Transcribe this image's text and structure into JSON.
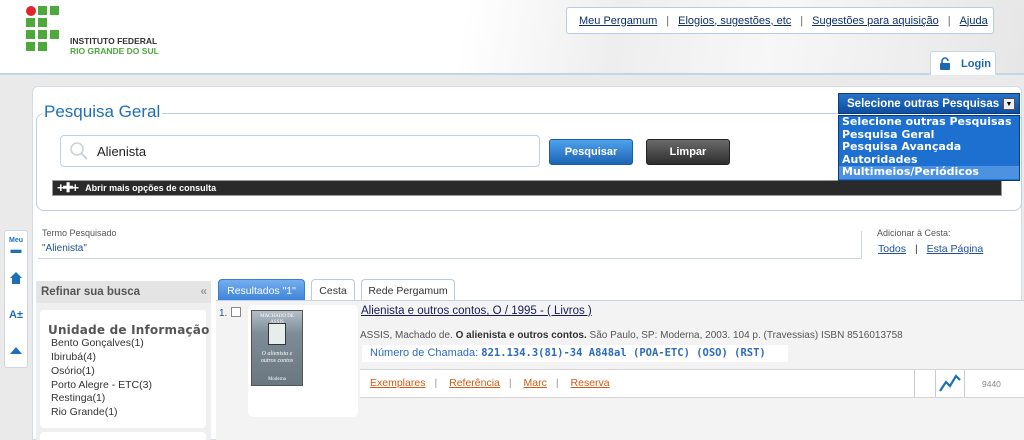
{
  "logo": {
    "line1": "INSTITUTO FEDERAL",
    "line2": "RIO GRANDE DO SUL",
    "brand_color": "#4ea93c",
    "dot_color": "#e0262c"
  },
  "topnav": {
    "items": [
      "Meu Pergamum",
      "Elogios, sugestões, etc",
      "Sugestões para aquisição",
      "Ajuda"
    ]
  },
  "login": {
    "label": "Login",
    "icon": "padlock-icon"
  },
  "search": {
    "legend": "Pesquisa Geral",
    "value": "Alienista",
    "search_button": "Pesquisar",
    "clear_button": "Limpar",
    "more_options": "Abrir mais opções de consulta"
  },
  "select_search": {
    "selected": "Selecione outras Pesquisas",
    "options": [
      "Selecione outras Pesquisas",
      "Pesquisa Geral",
      "Pesquisa Avançada",
      "Autoridades",
      "Multimeios/Periódicos"
    ],
    "highlighted_index": 4
  },
  "side_tools": {
    "items": [
      "Meu",
      "home-icon",
      "A±",
      "up-arrow-icon"
    ]
  },
  "termo": {
    "label": "Termo Pesquisado",
    "value": "\"Alienista\""
  },
  "cesta": {
    "label": "Adicionar à Cesta:",
    "all": "Todos",
    "sep": "|",
    "page": "Esta Página"
  },
  "refine": {
    "title": "Refinar sua busca",
    "unit_title": "Unidade de Informação",
    "units": [
      "Bento Gonçalves(1)",
      "Ibirubá(4)",
      "Osório(1)",
      "Porto Alegre - ETC(3)",
      "Restinga(1)",
      "Rio Grande(1)"
    ]
  },
  "tabs": [
    "Resultados \"1\"",
    "Cesta",
    "Rede Pergamum"
  ],
  "record": {
    "num": "1.",
    "title": "Alienista e outros contos, O / 1995 -  ( Livros )",
    "ref_prefix": "ASSIS, Machado de. ",
    "ref_bold": "O alienista e outros contos.",
    "ref_suffix": " São Paulo, SP: Moderna, 2003. 104 p. (Travessias) ISBN 8516013758",
    "call_label": "Número de Chamada: ",
    "call_value": "821.134.3(81)-34 A848al (POA-ETC) (OSO) (RST)",
    "cover_title": "O alienista e outros contos",
    "cover_author": "MACHADO DE ASSIS",
    "cover_publisher": "Moderna",
    "actions": [
      "Exemplares",
      "Referência",
      "Marc",
      "Reserva"
    ],
    "count": "9440"
  }
}
